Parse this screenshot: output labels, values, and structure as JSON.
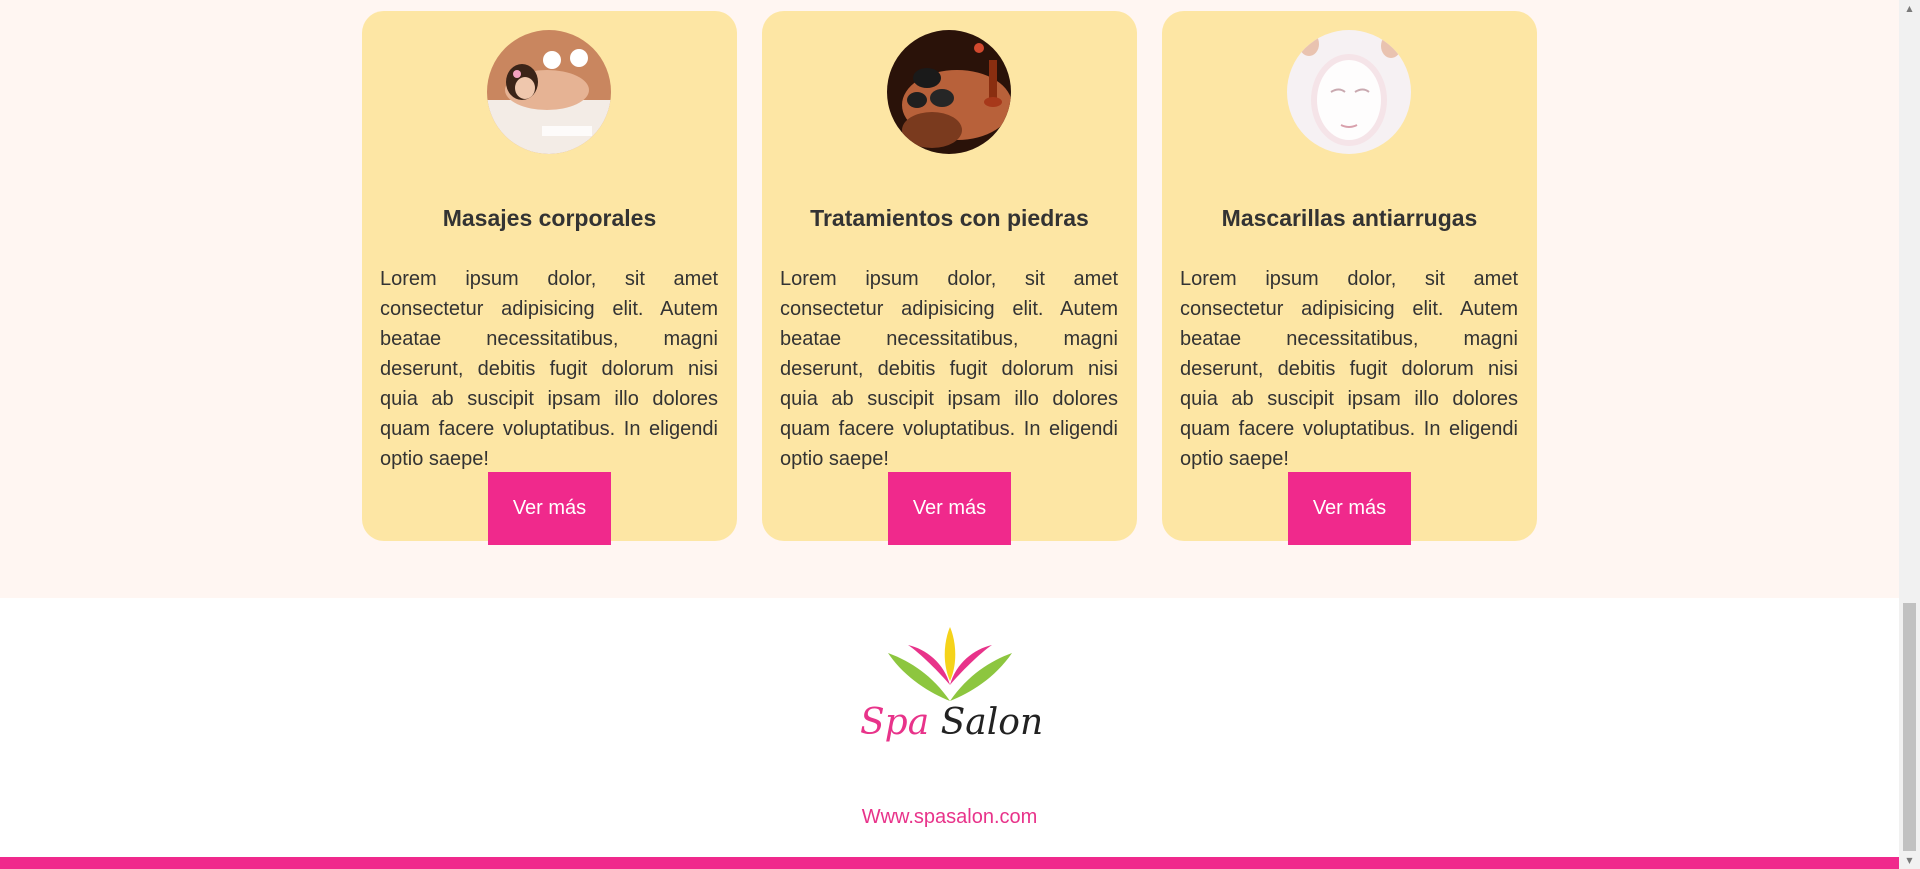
{
  "services": {
    "cards": [
      {
        "title": "Masajes corporales",
        "text": "Lorem ipsum dolor, sit amet consectetur adipisicing elit. Autem beatae necessitatibus, magni deserunt, debitis fugit dolorum nisi quia ab suscipit ipsam illo dolores quam facere voluptatibus. In eligendi optio saepe!",
        "button_label": "Ver más",
        "image": "hot-stone-back-massage-photo"
      },
      {
        "title": "Tratamientos con piedras",
        "text": "Lorem ipsum dolor, sit amet consectetur adipisicing elit. Autem beatae necessitatibus, magni deserunt, debitis fugit dolorum nisi quia ab suscipit ipsam illo dolores quam facere voluptatibus. In eligendi optio saepe!",
        "button_label": "Ver más",
        "image": "hot-stones-on-back-photo"
      },
      {
        "title": "Mascarillas antiarrugas",
        "text": "Lorem ipsum dolor, sit amet consectetur adipisicing elit. Autem beatae necessitatibus, magni deserunt, debitis fugit dolorum nisi quia ab suscipit ipsam illo dolores quam facere voluptatibus. In eligendi optio saepe!",
        "button_label": "Ver más",
        "image": "facial-sheet-mask-photo"
      }
    ]
  },
  "footer": {
    "logo": {
      "word1": "Spa",
      "word2": "Salon",
      "icon": "lotus-leaves-icon"
    },
    "website": "Www.spasalon.com"
  },
  "colors": {
    "accent": "#f0298c",
    "card_background": "#fde6a4",
    "section_background": "#fff6f2",
    "text": "#333333"
  }
}
